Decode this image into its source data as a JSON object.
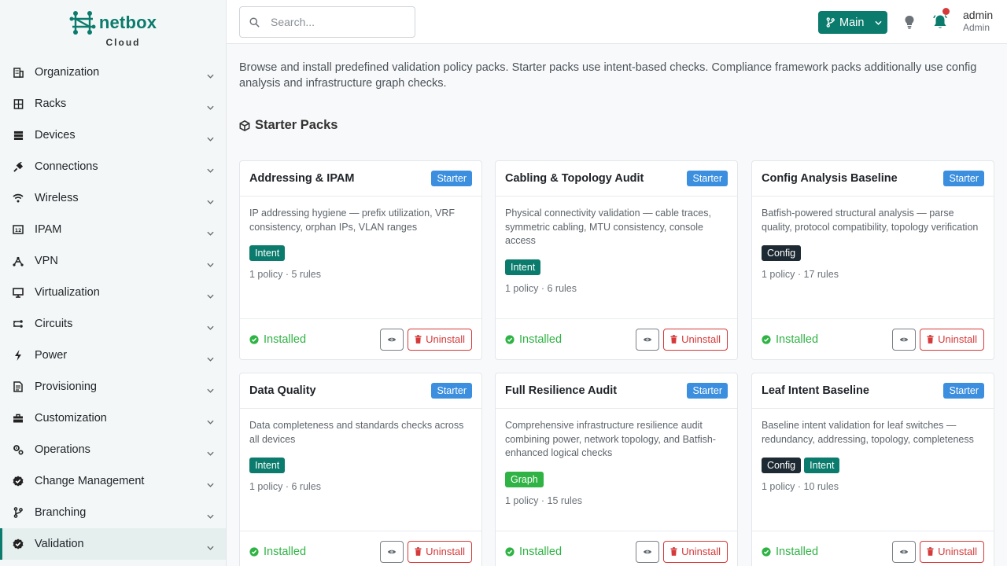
{
  "brand": {
    "name": "netbox",
    "sub": "Cloud"
  },
  "sidebar": {
    "items": [
      {
        "label": "Organization",
        "icon": "building-icon"
      },
      {
        "label": "Racks",
        "icon": "rack-icon"
      },
      {
        "label": "Devices",
        "icon": "server-icon"
      },
      {
        "label": "Connections",
        "icon": "plug-icon"
      },
      {
        "label": "Wireless",
        "icon": "wifi-icon"
      },
      {
        "label": "IPAM",
        "icon": "counter-icon"
      },
      {
        "label": "VPN",
        "icon": "tunnel-icon"
      },
      {
        "label": "Virtualization",
        "icon": "monitor-icon"
      },
      {
        "label": "Circuits",
        "icon": "transit-icon"
      },
      {
        "label": "Power",
        "icon": "bolt-icon"
      },
      {
        "label": "Provisioning",
        "icon": "file-icon"
      },
      {
        "label": "Customization",
        "icon": "toolbox-icon"
      },
      {
        "label": "Operations",
        "icon": "cog-icon"
      },
      {
        "label": "Change Management",
        "icon": "check-badge-icon"
      },
      {
        "label": "Branching",
        "icon": "branch-icon"
      },
      {
        "label": "Validation",
        "icon": "check-badge-icon",
        "active": true
      }
    ]
  },
  "header": {
    "search_placeholder": "Search...",
    "branch_label": "Main",
    "user_name": "admin",
    "user_role": "Admin"
  },
  "main": {
    "intro": "Browse and install predefined validation policy packs. Starter packs use intent-based checks. Compliance framework packs additionally use config analysis and infrastructure graph checks.",
    "section_title": "Starter Packs",
    "cards": [
      {
        "title": "Addressing & IPAM",
        "badge": "Starter",
        "desc": "IP addressing hygiene — prefix utilization, VRF consistency, orphan IPs, VLAN ranges",
        "tags": [
          {
            "label": "Intent",
            "kind": "intent"
          }
        ],
        "meta": "1 policy · 5 rules",
        "status": "Installed",
        "action": "Uninstall"
      },
      {
        "title": "Cabling & Topology Audit",
        "badge": "Starter",
        "desc": "Physical connectivity validation — cable traces, symmetric cabling, MTU consistency, console access",
        "tags": [
          {
            "label": "Intent",
            "kind": "intent"
          }
        ],
        "meta": "1 policy · 6 rules",
        "status": "Installed",
        "action": "Uninstall"
      },
      {
        "title": "Config Analysis Baseline",
        "badge": "Starter",
        "desc": "Batfish-powered structural analysis — parse quality, protocol compatibility, topology verification",
        "tags": [
          {
            "label": "Config",
            "kind": "config"
          }
        ],
        "meta": "1 policy · 17 rules",
        "status": "Installed",
        "action": "Uninstall"
      },
      {
        "title": "Data Quality",
        "badge": "Starter",
        "desc": "Data completeness and standards checks across all devices",
        "tags": [
          {
            "label": "Intent",
            "kind": "intent"
          }
        ],
        "meta": "1 policy · 6 rules",
        "status": "Installed",
        "action": "Uninstall"
      },
      {
        "title": "Full Resilience Audit",
        "badge": "Starter",
        "desc": "Comprehensive infrastructure resilience audit combining power, network topology, and Batfish-enhanced logical checks",
        "tags": [
          {
            "label": "Graph",
            "kind": "graph"
          }
        ],
        "meta": "1 policy · 15 rules",
        "status": "Installed",
        "action": "Uninstall"
      },
      {
        "title": "Leaf Intent Baseline",
        "badge": "Starter",
        "desc": "Baseline intent validation for leaf switches — redundancy, addressing, topology, completeness",
        "tags": [
          {
            "label": "Config",
            "kind": "config"
          },
          {
            "label": "Intent",
            "kind": "intent"
          }
        ],
        "meta": "1 policy · 10 rules",
        "status": "Installed",
        "action": "Uninstall"
      }
    ]
  },
  "colors": {
    "accent": "#0a7b6c",
    "starter": "#3b8fde",
    "success": "#2fb344",
    "danger": "#d63939"
  }
}
